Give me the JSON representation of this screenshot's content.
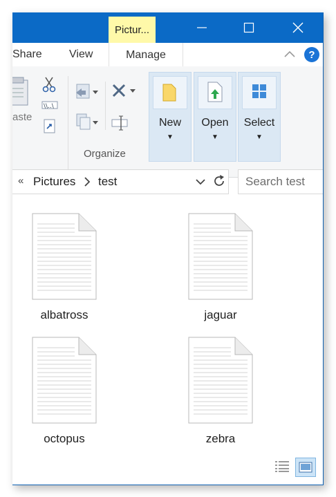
{
  "titlebar": {
    "context_tab": "Pictur...",
    "minimize_icon": "minimize-icon",
    "maximize_icon": "maximize-icon",
    "close_icon": "close-icon"
  },
  "ribbon_tabs": {
    "share": "Share",
    "view": "View",
    "manage": "Manage",
    "help": "?"
  },
  "ribbon": {
    "paste_label": "aste",
    "organize_label": "Organize",
    "new_label": "New",
    "open_label": "Open",
    "select_label": "Select"
  },
  "address": {
    "chevron": "«",
    "crumbs": [
      "Pictures",
      "test"
    ],
    "separator": "›"
  },
  "search": {
    "placeholder": "Search test"
  },
  "files": [
    {
      "name": "albatross"
    },
    {
      "name": "jaguar"
    },
    {
      "name": "octopus"
    },
    {
      "name": "zebra"
    }
  ],
  "colors": {
    "titlebar": "#0b6ac6",
    "context_tab": "#fff9a9",
    "selected_button": "#dbe8f4"
  }
}
